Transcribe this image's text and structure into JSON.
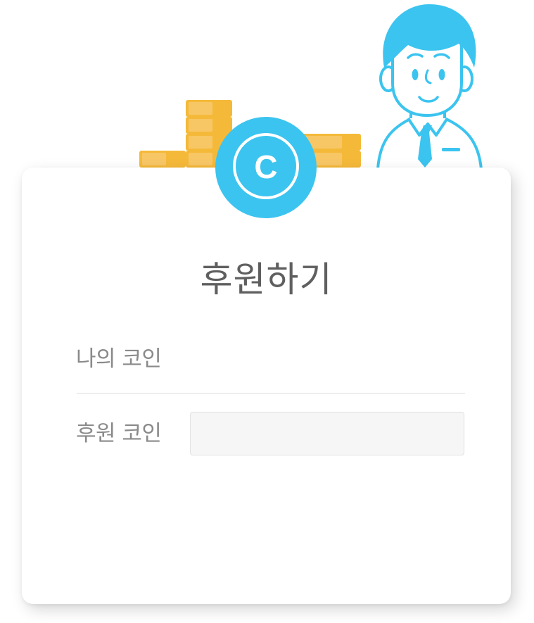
{
  "dialog": {
    "title": "후원하기",
    "coin_symbol": "C"
  },
  "form": {
    "my_coin_label": "나의 코인",
    "my_coin_value": "",
    "donate_coin_label": "후원 코인",
    "donate_coin_value": "",
    "donate_coin_placeholder": ""
  },
  "colors": {
    "accent_blue": "#3bc4ef",
    "coin_gold": "#f5b93a",
    "coin_gold_light": "#f8c765",
    "title_text": "#5f5f5f",
    "label_text": "#8a8a8a",
    "input_bg": "#f6f6f6"
  },
  "icons": {
    "coin_stack": "coin-stack-icon",
    "coin_badge": "coin-badge-icon",
    "character": "man-character-illustration"
  }
}
